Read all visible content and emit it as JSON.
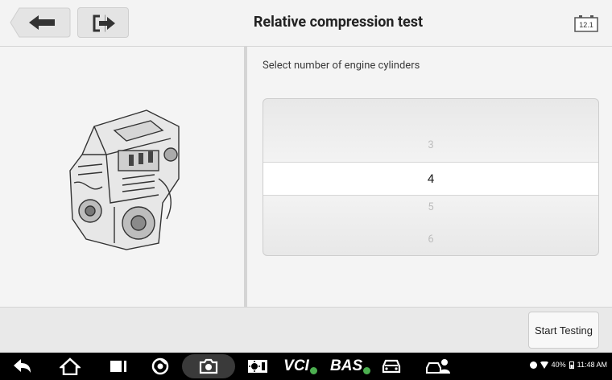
{
  "toolbar": {
    "title": "Relative compression test",
    "battery_label": "12.1"
  },
  "main": {
    "prompt": "Select number of engine cylinders",
    "picker": {
      "options": [
        "3",
        "4",
        "5",
        "6"
      ],
      "selected": "4"
    }
  },
  "actions": {
    "start_label": "Start Testing"
  },
  "navbar": {
    "vci_label": "VCI",
    "bas_label": "BAS"
  },
  "status": {
    "battery": "40%",
    "time": "11:48 AM"
  },
  "icons": [
    "back-arrow-icon",
    "exit-icon",
    "battery-voltage-icon",
    "engine-image",
    "home-icon",
    "recent-apps-icon",
    "browser-icon",
    "camera-icon",
    "display-brightness-icon",
    "vci-icon",
    "bas-icon",
    "car-icon",
    "remote-support-icon",
    "bluetooth-icon",
    "wifi-icon",
    "battery-icon"
  ]
}
